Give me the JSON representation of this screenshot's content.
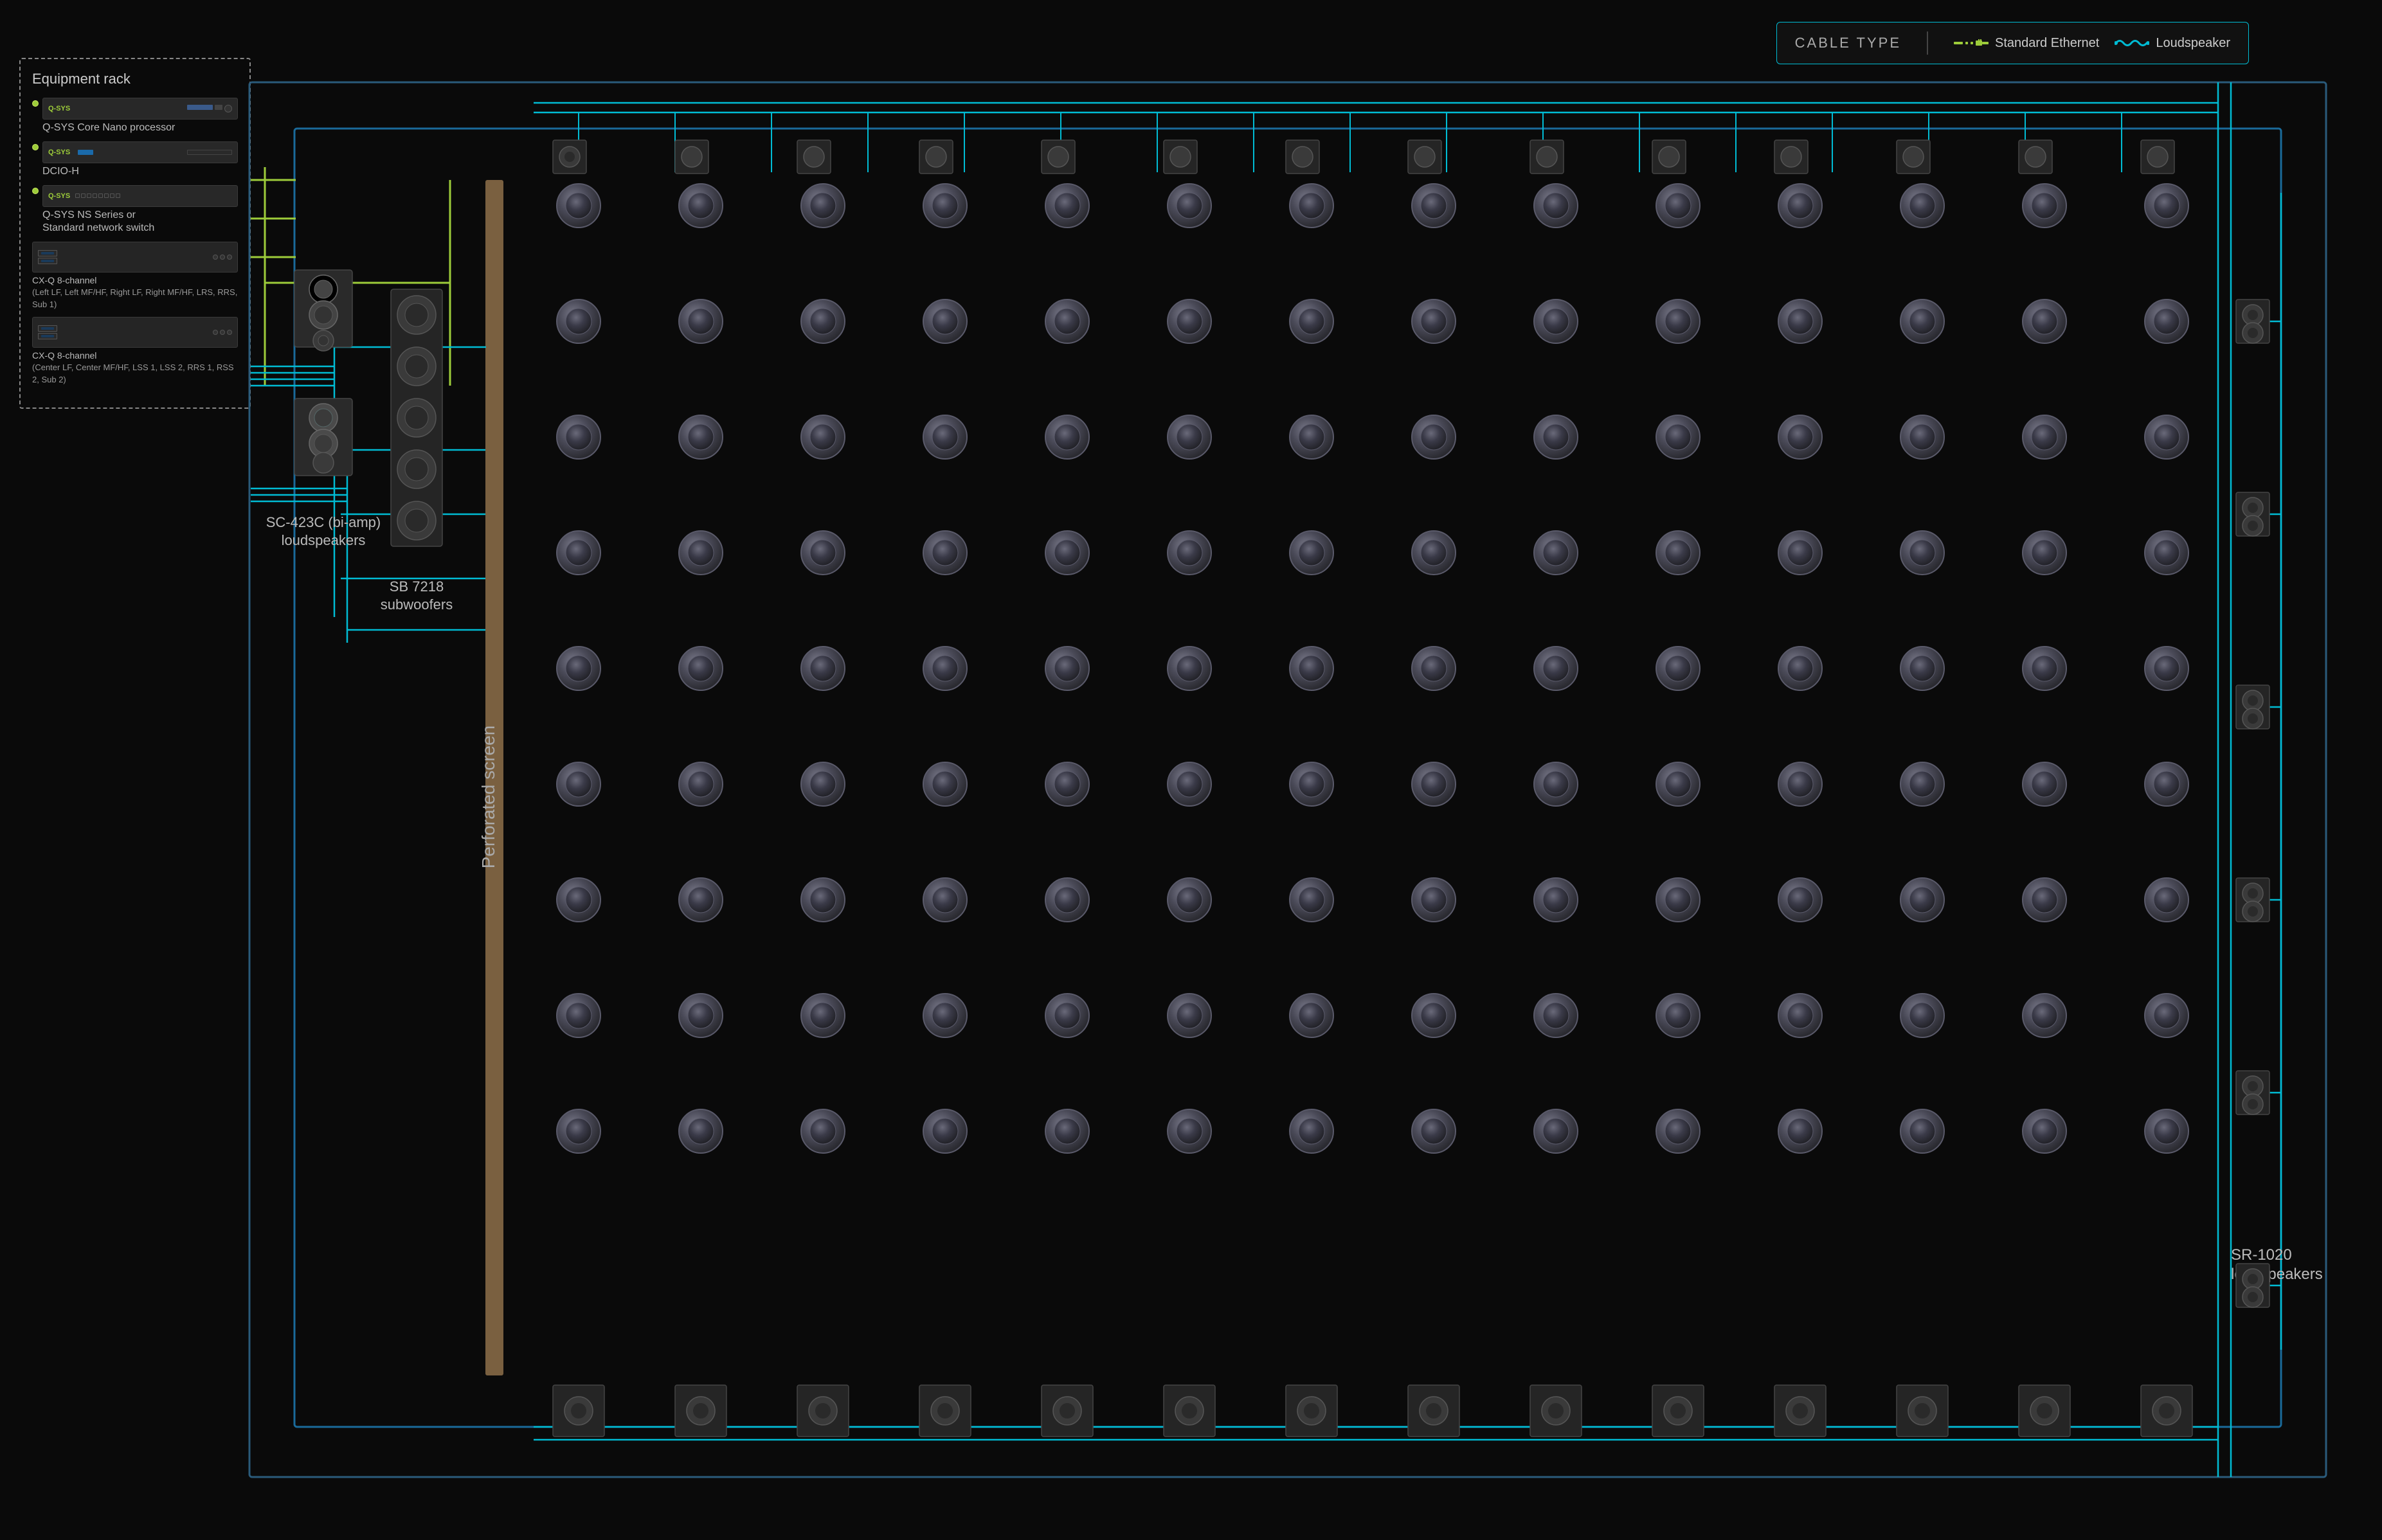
{
  "legend": {
    "title": "CABLE TYPE",
    "ethernet_label": "Standard Ethernet",
    "loudspeaker_label": "Loudspeaker"
  },
  "rack": {
    "title": "Equipment rack",
    "devices": [
      {
        "id": "core-nano",
        "brand": "Q-SYS",
        "name": "Q-SYS Core Nano processor"
      },
      {
        "id": "dcio-h",
        "brand": "Q-SYS",
        "name": "DCIO-H"
      },
      {
        "id": "ns-series",
        "brand": "Q-SYS",
        "name": "Q-SYS NS Series or\nStandard network switch"
      },
      {
        "id": "cx-q-1",
        "brand": "",
        "name": "CX-Q 8-channel\n(Left LF, Left MF/HF, Right LF, Right MF/HF, LRS, RRS, Sub 1)"
      },
      {
        "id": "cx-q-2",
        "brand": "",
        "name": "CX-Q 8-channel\n(Center LF, Center MF/HF, LSS 1, LSS 2, RRS 1, RSS 2, Sub 2)"
      }
    ]
  },
  "theater": {
    "screen_label": "Perforated\nscreen",
    "speakers": {
      "sb7218_label": "SB 7218\nsubwoofers",
      "sc423c_label": "SC-423C (bi-amp)\nloudspeakers",
      "sr1020_label": "SR-1020\nloudspeakers"
    }
  }
}
